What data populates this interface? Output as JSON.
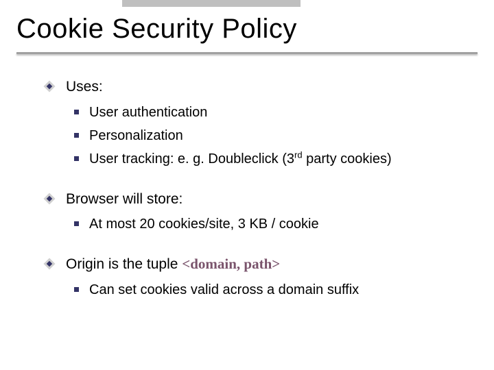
{
  "title": "Cookie Security Policy",
  "groups": [
    {
      "heading": "Uses:",
      "items": [
        {
          "text": "User authentication"
        },
        {
          "text": "Personalization"
        },
        {
          "prefix": "User tracking:   e. g.   Doubleclick   (3",
          "sup": "rd",
          "suffix": " party cookies)"
        }
      ]
    },
    {
      "heading": "Browser will store:",
      "items": [
        {
          "text": "At most  20 cookies/site,      3 KB / cookie"
        }
      ]
    },
    {
      "heading_prefix": "Origin is the tuple   ",
      "heading_accent": "<domain, path>",
      "items": [
        {
          "text": "Can set cookies valid across a domain suffix"
        }
      ]
    }
  ]
}
